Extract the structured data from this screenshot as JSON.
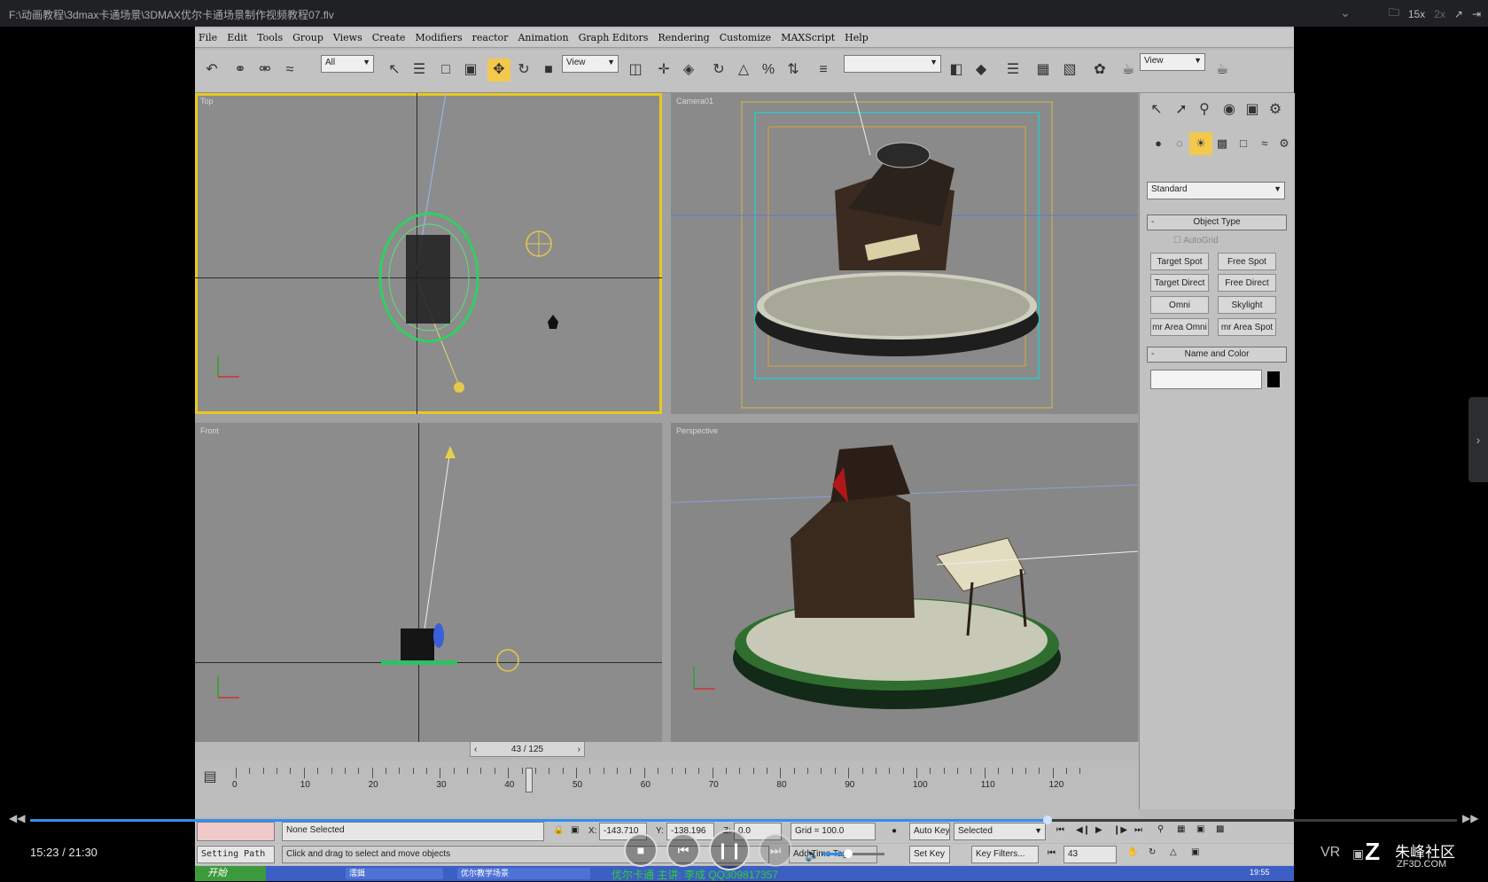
{
  "player": {
    "file_path": "F:\\动画教程\\3dmax卡通场景\\3DMAX优尔卡通场景制作视频教程07.flv",
    "speed_label": "15x",
    "speed_alt": "2x",
    "current_time": "15:23",
    "total_time": "21:30",
    "time_display": "15:23 / 21:30",
    "progress": 0.713,
    "volume": 0.42,
    "vr_label": "VR",
    "brand_text": "朱峰社区",
    "brand_url": "ZF3D.COM",
    "accent_color": "#2f8ff2"
  },
  "max": {
    "menu": [
      "File",
      "Edit",
      "Tools",
      "Group",
      "Views",
      "Create",
      "Modifiers",
      "reactor",
      "Animation",
      "Graph Editors",
      "Rendering",
      "Customize",
      "MAXScript",
      "Help"
    ],
    "selection_filter": "All",
    "ref_coord": "View",
    "ref_coord2": "View",
    "viewports": {
      "top_label": "Top",
      "camera_label": "Camera01",
      "front_label": "Front",
      "persp_label": "Perspective"
    },
    "command_panel": {
      "category": "Standard",
      "object_type_title": "Object Type",
      "autogrid": "AutoGrid",
      "buttons": [
        "Target Spot",
        "Free Spot",
        "Target Direct",
        "Free Direct",
        "Omni",
        "Skylight",
        "mr Area Omni",
        "mr Area Spot"
      ],
      "name_color_title": "Name and Color"
    },
    "time_slider": "43 / 125",
    "ruler_labels": [
      "0",
      "10",
      "20",
      "30",
      "40",
      "50",
      "60",
      "70",
      "80",
      "90",
      "100",
      "110",
      "120"
    ],
    "status": {
      "selection": "None Selected",
      "x_label": "X:",
      "x_value": "-143.710",
      "y_label": "Y:",
      "y_value": "-138.196",
      "z_label": "Z:",
      "z_value": "0.0",
      "grid": "Grid = 100.0",
      "auto_key": "Auto Key",
      "key_mode": "Selected",
      "set_key": "Set Key",
      "key_filters": "Key Filters...",
      "frame": "43"
    },
    "prompt": {
      "left": "Setting Path",
      "message": "Click and drag to select and move objects",
      "add_time_tag": "Add Time Tag"
    },
    "taskbar": {
      "start": "开始",
      "task1": "濡鍓",
      "task2": "优尔教学场景",
      "marquee": "优尔卡通 主讲: 李成 QQ309817357",
      "clock": "19:55"
    }
  }
}
